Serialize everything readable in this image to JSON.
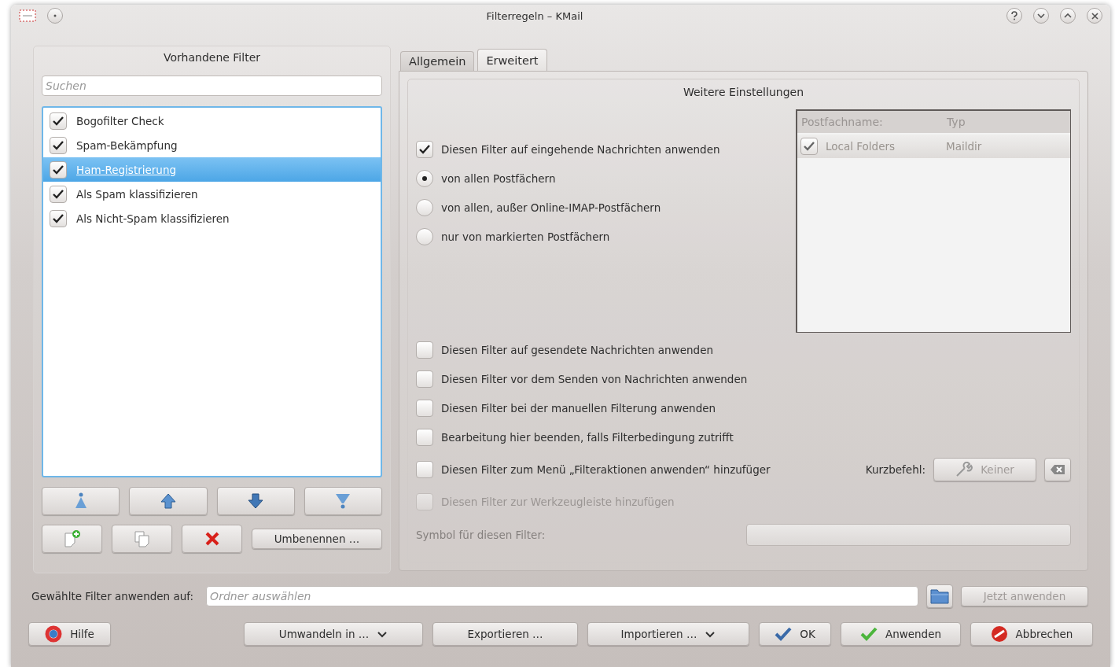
{
  "window": {
    "title": "Filterregeln – KMail"
  },
  "filters": {
    "heading": "Vorhandene Filter",
    "search": {
      "placeholder": "Suchen"
    },
    "items": [
      {
        "label": "Bogofilter Check",
        "checked": true,
        "selected": false
      },
      {
        "label": "Spam-Bekämpfung",
        "checked": true,
        "selected": false
      },
      {
        "label": "Ham-Registrierung",
        "checked": true,
        "selected": true
      },
      {
        "label": "Als Spam klassifizieren",
        "checked": true,
        "selected": false
      },
      {
        "label": "Als Nicht-Spam klassifizieren",
        "checked": true,
        "selected": false
      }
    ],
    "move_buttons": [
      {
        "kind": "top"
      },
      {
        "kind": "up"
      },
      {
        "kind": "down"
      },
      {
        "kind": "bottom"
      }
    ],
    "edit_buttons": [
      {
        "kind": "new"
      },
      {
        "kind": "copy"
      },
      {
        "kind": "delete"
      }
    ],
    "rename_button": "Umbenennen …"
  },
  "tabs": [
    {
      "label": "Allgemein",
      "selected": false
    },
    {
      "label": "Erweitert",
      "selected": true
    }
  ],
  "advanced": {
    "title": "Weitere Einstellungen",
    "incoming": {
      "label": "Diesen Filter auf eingehende Nachrichten anwenden",
      "checked": true
    },
    "sources": [
      {
        "label": "von allen Postfächern",
        "selected": true
      },
      {
        "label": "von allen, außer Online-IMAP-Postfächern",
        "selected": false
      },
      {
        "label": "nur von markierten Postfächern",
        "selected": false
      }
    ],
    "mailbox_table": {
      "columns": [
        "Postfachname:",
        "Typ"
      ],
      "rows": [
        {
          "name": "Local Folders",
          "type": "Maildir",
          "checked": true
        }
      ]
    },
    "options": [
      {
        "kind": "checkbox",
        "label": "Diesen Filter auf gesendete Nachrichten anwenden",
        "checked": false,
        "disabled": false
      },
      {
        "kind": "checkbox",
        "label": "Diesen Filter vor dem Senden von Nachrichten anwenden",
        "checked": false,
        "disabled": false
      },
      {
        "kind": "checkbox",
        "label": "Diesen Filter bei der manuellen Filterung anwenden",
        "checked": false,
        "disabled": false
      },
      {
        "kind": "checkbox",
        "label": "Bearbeitung hier beenden, falls Filterbedingung zutrifft",
        "checked": false,
        "disabled": false
      },
      {
        "kind": "shortcut",
        "label": "Diesen Filter zum Menü „Filteraktionen anwenden“ hinzufüger",
        "checked": false,
        "disabled": false,
        "shortcut_label": "Kurzbefehl:",
        "shortcut_button": "Keiner"
      },
      {
        "kind": "checkbox",
        "label": "Diesen Filter zur Werkzeugleiste hinzufügen",
        "checked": false,
        "disabled": true
      }
    ],
    "symbol": {
      "label": "Symbol für diesen Filter:",
      "disabled": true
    }
  },
  "apply": {
    "label": "Gewählte Filter anwenden auf:",
    "placeholder": "Ordner auswählen",
    "button": "Jetzt anwenden",
    "button_disabled": true
  },
  "footer": {
    "help": "Hilfe",
    "buttons": [
      {
        "kind": "menu",
        "label": "Umwandeln in …"
      },
      {
        "kind": "plain",
        "label": "Exportieren …"
      },
      {
        "kind": "menu",
        "label": "Importieren …"
      },
      {
        "kind": "ok",
        "label": "OK"
      },
      {
        "kind": "apply",
        "label": "Anwenden"
      },
      {
        "kind": "cancel",
        "label": "Abbrechen"
      }
    ]
  }
}
